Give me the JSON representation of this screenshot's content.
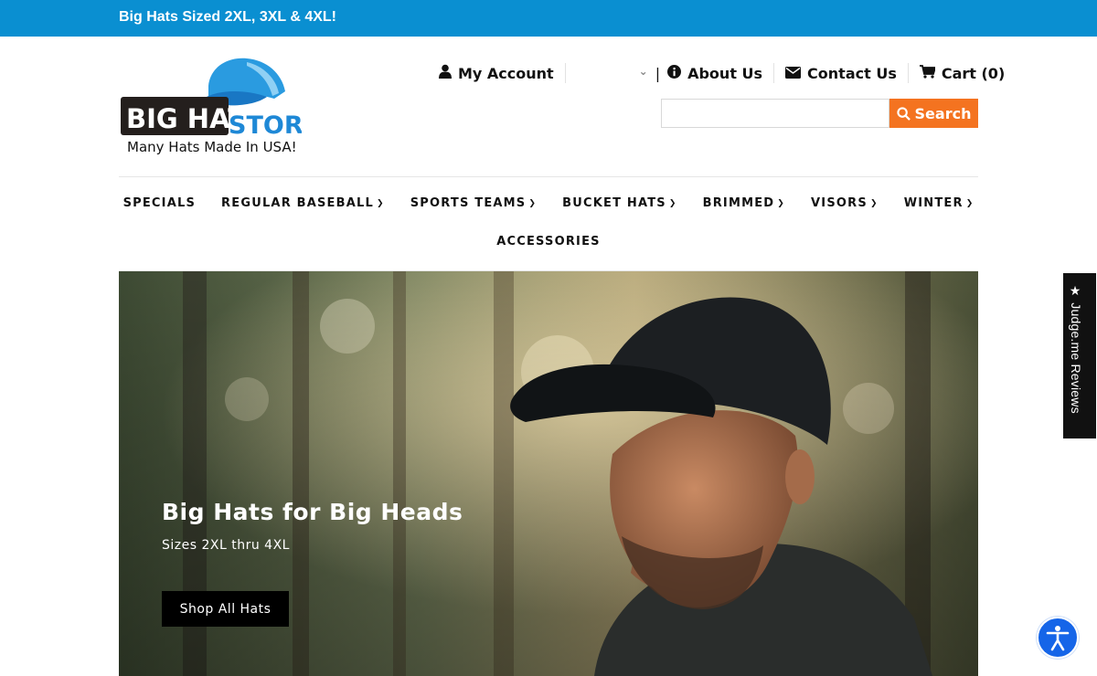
{
  "announcement": "Big Hats Sized 2XL, 3XL & 4XL!",
  "logo": {
    "word1": "BIG HAT",
    "word2": "STORE",
    "tagline": "Many Hats Made In USA!"
  },
  "topnav": {
    "account": "My Account",
    "pipe": "|",
    "about": "About Us",
    "contact": "Contact Us",
    "cart": "Cart (0)"
  },
  "search": {
    "placeholder": "",
    "button": "Search"
  },
  "mainnav": {
    "items": [
      "SPECIALS",
      "REGULAR BASEBALL",
      "SPORTS TEAMS",
      "BUCKET HATS",
      "BRIMMED",
      "VISORS",
      "WINTER"
    ],
    "row2": "ACCESSORIES"
  },
  "hero": {
    "title": "Big Hats for Big Heads",
    "subtitle": "Sizes 2XL thru 4XL",
    "button": "Shop All Hats"
  },
  "reviews_tab": "★ Judge.me Reviews",
  "colors": {
    "announce": "#0a8fd1",
    "search_button": "#f47320",
    "logo_blue": "#1e88d6",
    "accessibility": "#1565e8"
  },
  "icons": [
    "user-icon",
    "chevron-down-icon",
    "info-icon",
    "envelope-icon",
    "cart-icon",
    "search-icon",
    "accessibility-icon"
  ]
}
